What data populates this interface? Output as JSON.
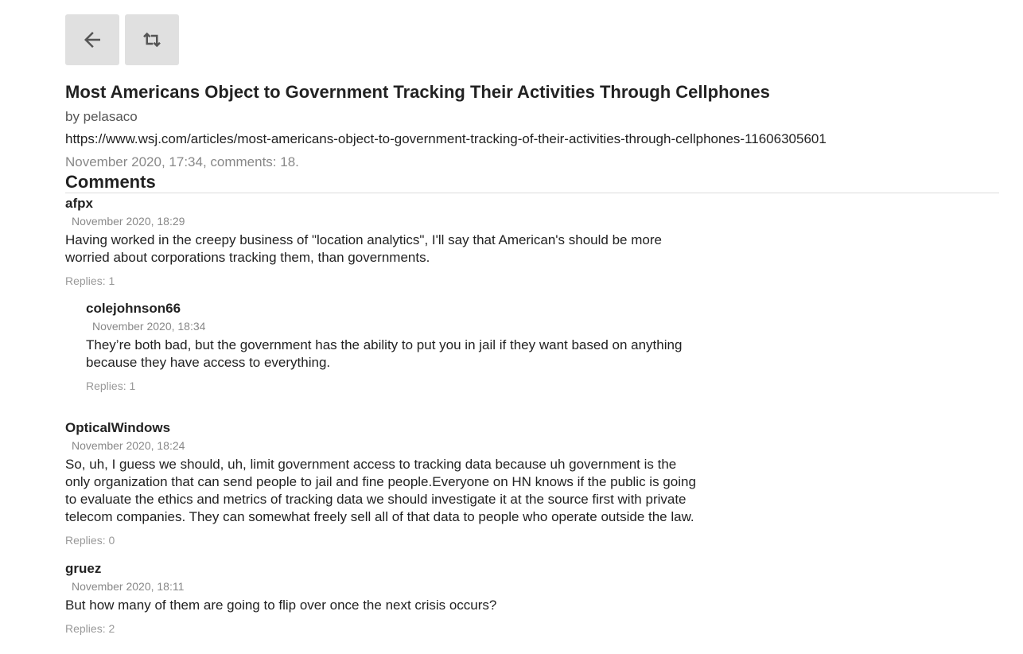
{
  "toolbar": {
    "back_icon": "arrow-left-icon",
    "repost_icon": "retweet-icon"
  },
  "story": {
    "title": "Most Americans Object to Government Tracking Their Activities Through Cellphones",
    "byline": "by pelasaco",
    "url": "https://www.wsj.com/articles/most-americans-object-to-government-tracking-of-their-activities-through-cellphones-11606305601",
    "meta": "November 2020, 17:34, comments: 18."
  },
  "comments_heading": "Comments",
  "comments": [
    {
      "author": "afpx",
      "date": "November 2020, 18:29",
      "text": "Having worked in the creepy business of \"location analytics\", I'll say that American's should be more worried about corporations tracking them, than governments.",
      "replies": "Replies: 1"
    },
    {
      "author": "colejohnson66",
      "date": "November 2020, 18:34",
      "text": "They’re both bad, but the government has the ability to put you in jail if they want based on anything because they have access to everything.",
      "replies": "Replies: 1"
    },
    {
      "author": "OpticalWindows",
      "date": "November 2020, 18:24",
      "text": "So, uh, I guess we should, uh, limit government access to tracking data because uh government is the only organization that can send people to jail and fine people.Everyone on HN knows if the public is going to evaluate the ethics and metrics of tracking data we should investigate it at the source first with private telecom companies. They can somewhat freely sell all of that data to people who operate outside the law.",
      "replies": "Replies: 0"
    },
    {
      "author": "gruez",
      "date": "November 2020, 18:11",
      "text": "But how many of them are going to flip over once the next crisis occurs?",
      "replies": "Replies: 2"
    }
  ]
}
